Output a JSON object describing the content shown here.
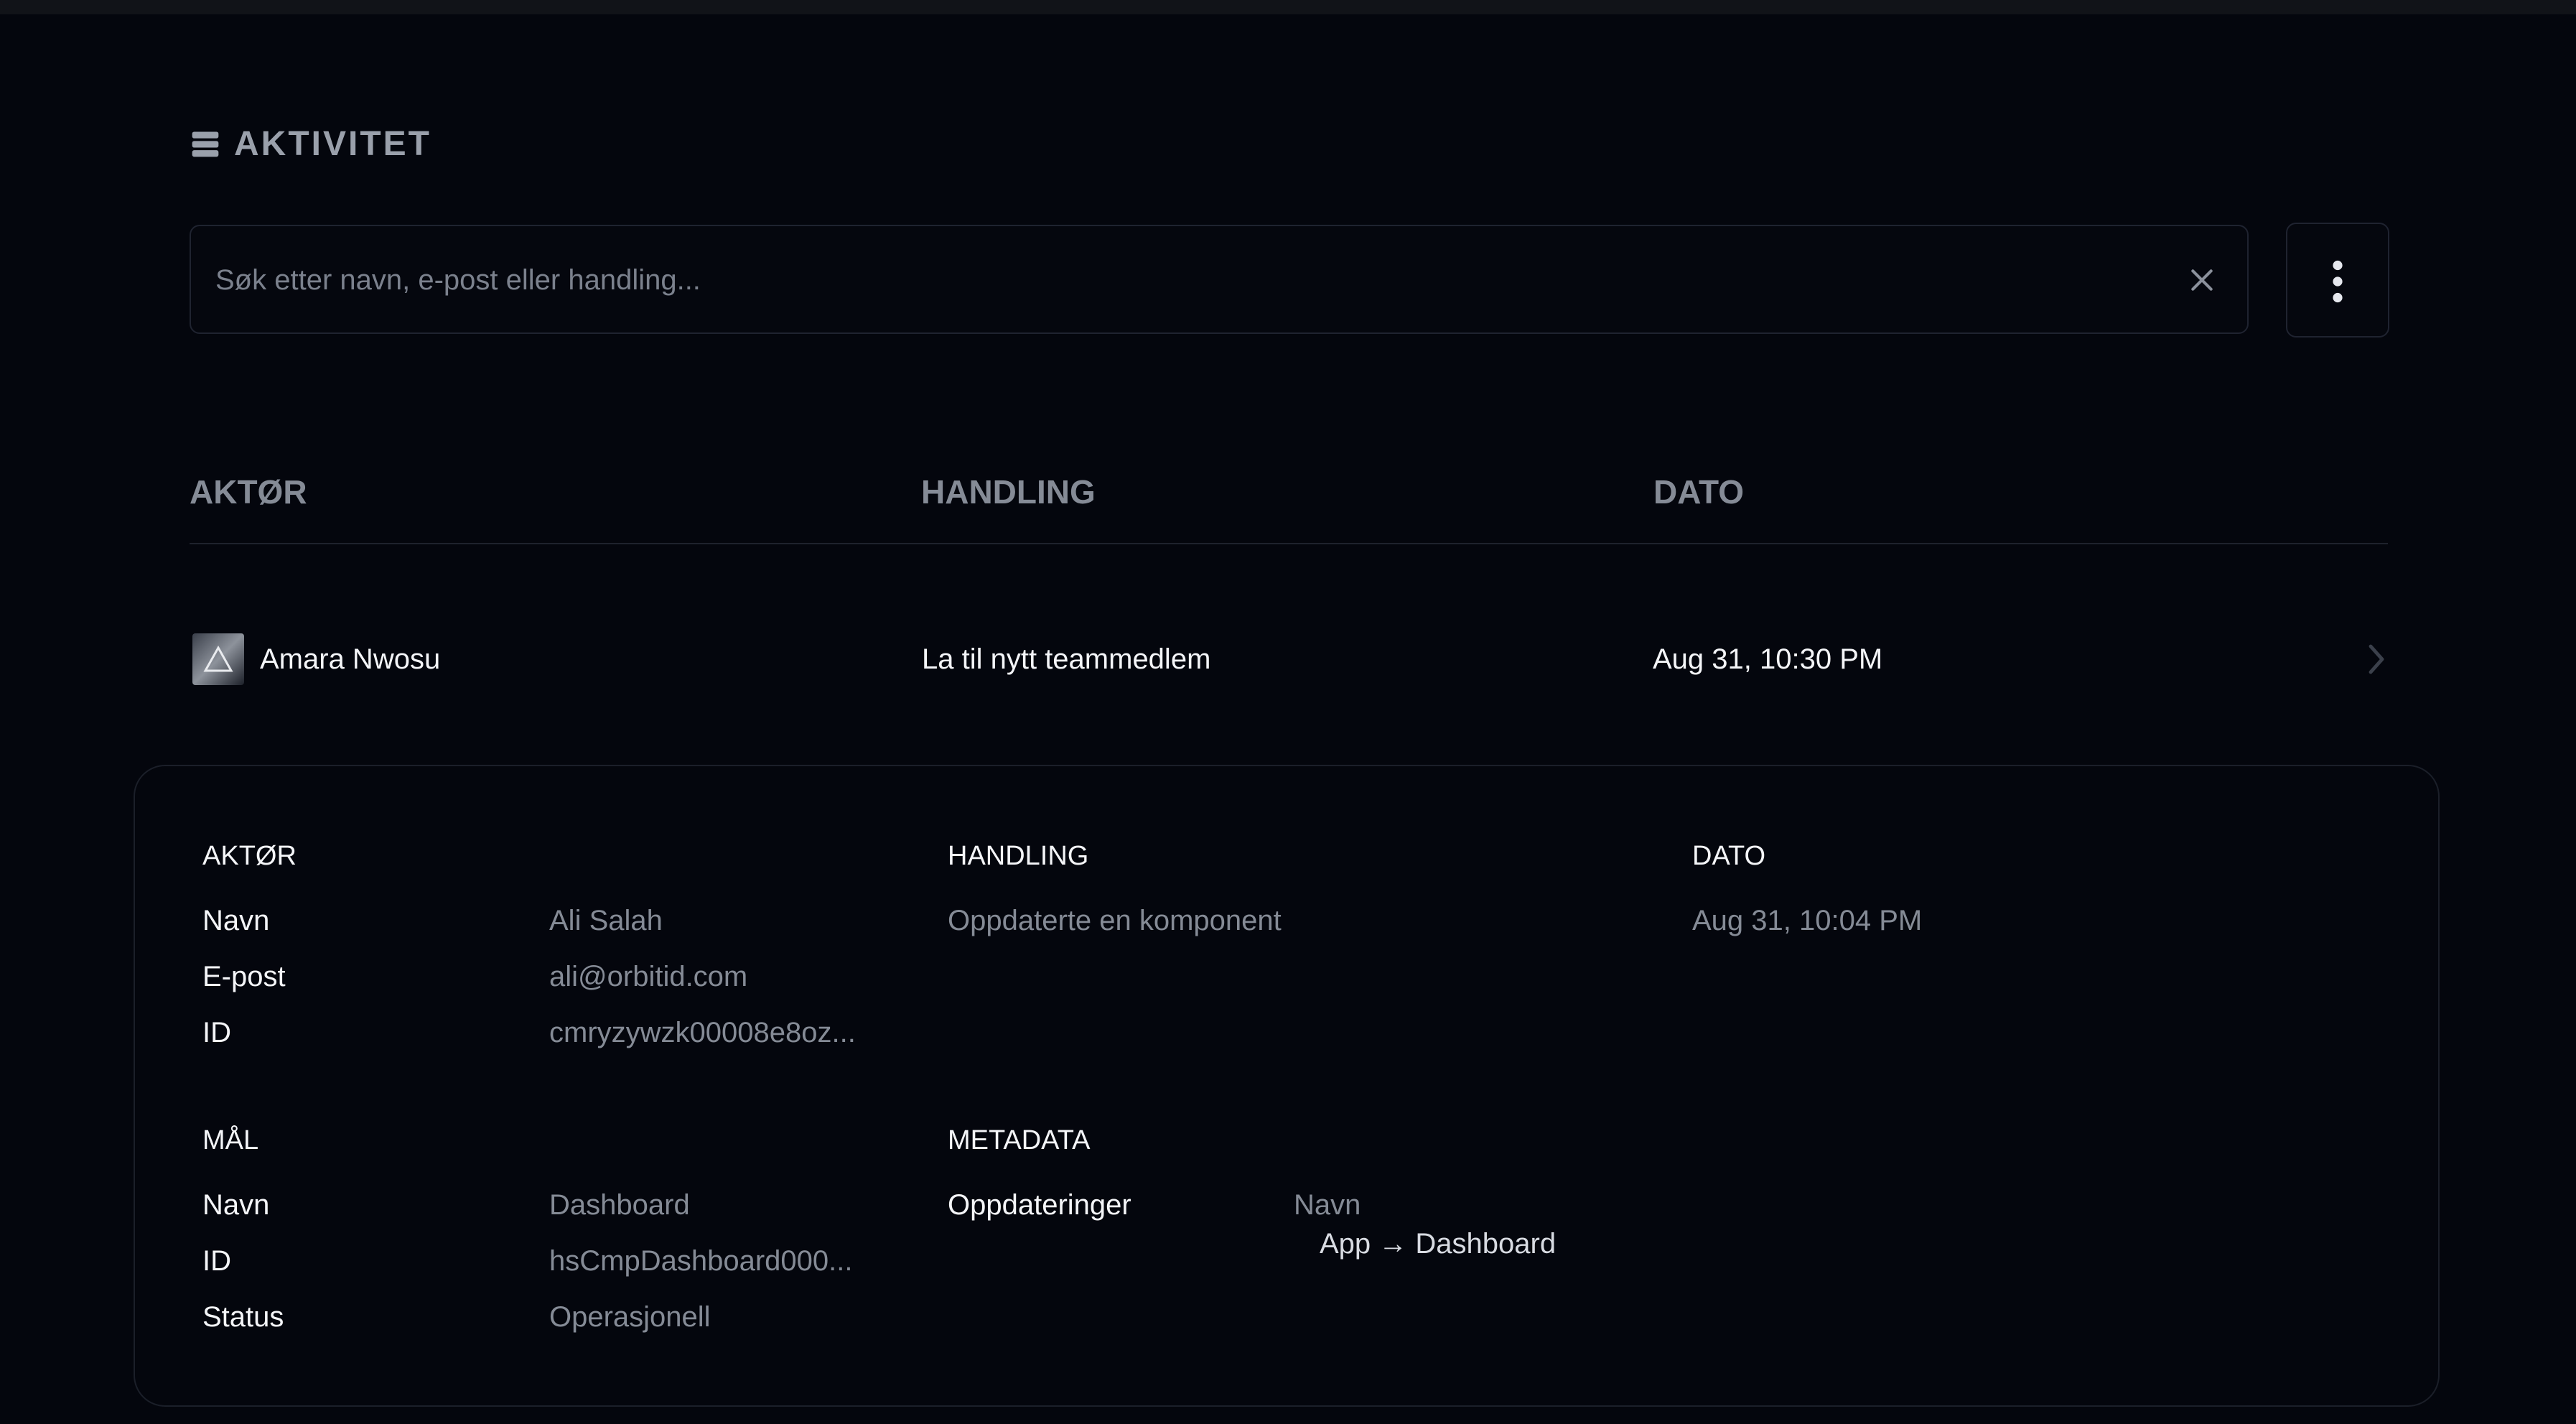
{
  "section": {
    "title": "AKTIVITET",
    "icon": "server-stack-icon"
  },
  "search": {
    "placeholder": "Søk etter navn, e-post eller handling...",
    "value": ""
  },
  "table": {
    "columns": [
      "AKTØR",
      "HANDLING",
      "DATO"
    ],
    "rows": [
      {
        "actor": "Amara Nwosu",
        "action": "La til nytt teammedlem",
        "date": "Aug 31, 10:30 PM"
      }
    ]
  },
  "detail": {
    "actor": {
      "heading": "AKTØR",
      "fields": [
        {
          "label": "Navn",
          "value": "Ali Salah"
        },
        {
          "label": "E-post",
          "value": "ali@orbitid.com"
        },
        {
          "label": "ID",
          "value": "cmryzywzk00008e8oz..."
        }
      ]
    },
    "action": {
      "heading": "HANDLING",
      "value": "Oppdaterte en komponent"
    },
    "date": {
      "heading": "DATO",
      "value": "Aug 31, 10:04 PM"
    },
    "target": {
      "heading": "MÅL",
      "fields": [
        {
          "label": "Navn",
          "value": "Dashboard"
        },
        {
          "label": "ID",
          "value": "hsCmpDashboard000..."
        },
        {
          "label": "Status",
          "value": "Operasjonell"
        }
      ]
    },
    "metadata": {
      "heading": "METADATA",
      "label": "Oppdateringer",
      "key": "Navn",
      "change": "App → Dashboard"
    }
  },
  "colors": {
    "background": "#04060d",
    "border": "#1f2330",
    "muted_text": "#858b96",
    "primary_text": "#f4f5f8"
  }
}
